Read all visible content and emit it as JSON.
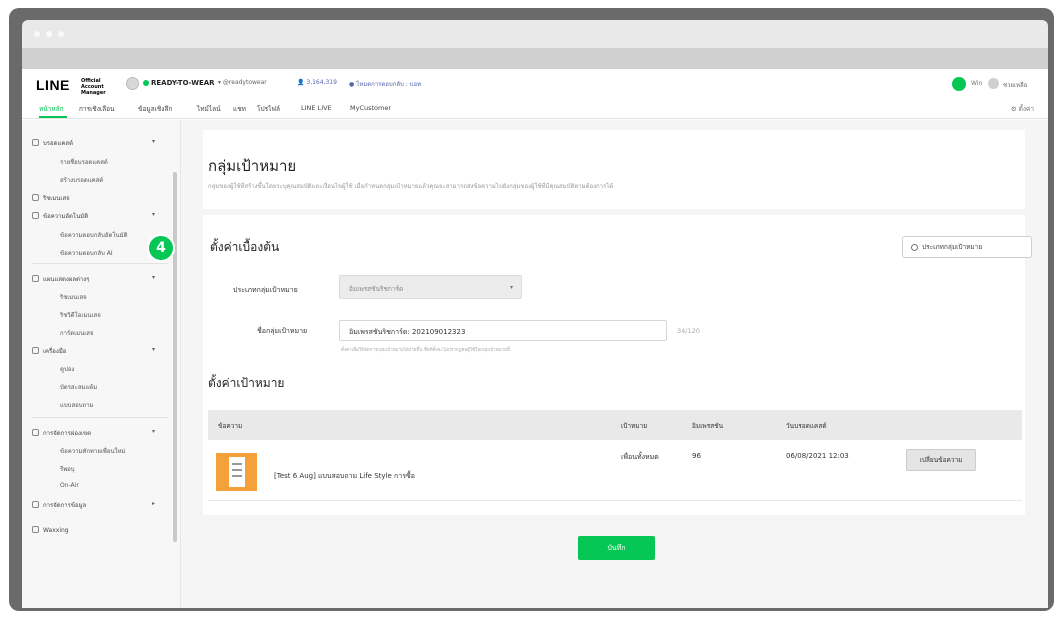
{
  "header": {
    "logo": "LINE",
    "logo_sub": "Official Account Manager",
    "account_name": "READY-TO-WEAR",
    "account_id": "▾ @readytowear",
    "followers": "👤 3,164,319",
    "plan": "● โหมดการตอบกลับ : บอท",
    "user_label": "Win",
    "help_label": "ช่วยเหลือ"
  },
  "nav": {
    "items": [
      "หน้าหลัก",
      "การเชิงเลือน",
      "ข้อมูลเชิงลึก",
      "ไทม์ไลน์",
      "แชท",
      "โปรไฟล์",
      "LINE LIVE",
      "MyCustomer"
    ],
    "settings": "⚙ ตั้งค่า"
  },
  "sidebar": {
    "items": [
      {
        "label": "บรอดแคสต์",
        "group": true
      },
      {
        "label": "รายชื่อบรอดแคสต์"
      },
      {
        "label": "สร้างบรอดแคสต์"
      },
      {
        "label": "ริชเมนเสจ",
        "group": true
      },
      {
        "label": "ข้อความอัตโนมัติ",
        "group": true
      },
      {
        "label": "ข้อความตอบกลับอัตโนมัติ"
      },
      {
        "label": "ข้อความตอบกลับ AI"
      },
      {
        "label": "แผนแสดงผลต่างๆ",
        "group": true
      },
      {
        "label": "ริชเมนเสจ"
      },
      {
        "label": "ริชวิดีโอเมนเสจ"
      },
      {
        "label": "การ์ดเมนเสจ"
      },
      {
        "label": "เครื่องมือ",
        "group": true
      },
      {
        "label": "คูปอง"
      },
      {
        "label": "บัตรสะสมแต้ม"
      },
      {
        "label": "แบบสอบถาม"
      },
      {
        "label": "การจัดการผ่องเขต",
        "group": true
      },
      {
        "label": "ข้อความทักทายเพื่อนใหม่"
      },
      {
        "label": "รีพอบุ"
      },
      {
        "label": "On-Air"
      },
      {
        "label": "การจัดการข้อมูล",
        "group": true
      },
      {
        "label": "Waxxing",
        "group": true
      }
    ]
  },
  "page": {
    "title": "กลุ่มเป้าหมาย",
    "description": "กลุ่มของผู้ใช้ที่สร้างขึ้นโดยระบุคุณสมบัติและเงื่อนไขผู้ใช้ เมื่อกำหนดกลุ่มเป้าหมายแล้วคุณจะสามารถส่งข้อความไปยังกลุ่มของผู้ใช้ที่มีคุณสมบัติตามต้องการได้"
  },
  "marker": "4",
  "basic_settings": {
    "title": "ตั้งค่าเบื้องต้น",
    "type_button": "ประเภทกลุ่มเป้าหมาย",
    "type_label": "ประเภทกลุ่มเป้าหมาย",
    "type_value": "อิมเพรสชันริชการ์ด",
    "name_label": "ชื่อกลุ่มเป้าหมาย",
    "name_value": "อิมเพรสชันริชการ์ด: 202109012323",
    "name_counter": "34/120",
    "name_hint": "ตั้งค่าเพื่อให้จัดการกลุ่มเป้าหมายได้ง่ายขึ้น ชื่อที่ตั้งจะไม่ปรากฏต่อผู้ใช้ในกลุ่มเป้าหมายนี้"
  },
  "target_settings": {
    "title": "ตั้งค่าเป้าหมาย",
    "columns": [
      "ข้อความ",
      "เป้าหมาย",
      "อิมเพรสชัน",
      "วันบรอดแคสต์"
    ],
    "rows": [
      {
        "message": "[Test 6 Aug] แบบสอบถาม Life Style การซื้อ",
        "target": "เพื่อนทั้งหมด",
        "impressions": "96",
        "broadcast_date": "06/08/2021 12:03",
        "action": "เปลี่ยนข้อความ"
      }
    ]
  },
  "save_button": "บันทึก",
  "colors": {
    "accent": "#06c755"
  }
}
